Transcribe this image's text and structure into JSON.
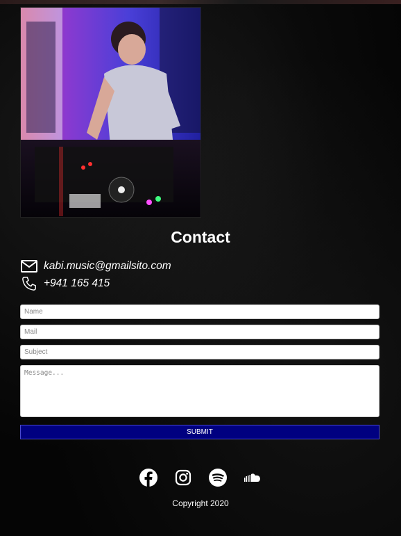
{
  "contact": {
    "title": "Contact",
    "email": "kabi.music@gmailsito.com",
    "phone": "+941 165 415"
  },
  "form": {
    "name_placeholder": "Name",
    "mail_placeholder": "Mail",
    "subject_placeholder": "Subject",
    "message_placeholder": "Message...",
    "submit_label": "SUBMIT"
  },
  "social": [
    "facebook-icon",
    "instagram-icon",
    "spotify-icon",
    "soundcloud-icon"
  ],
  "footer": {
    "copyright": "Copyright 2020"
  },
  "colors": {
    "submit_bg": "#000080",
    "background": "#050505",
    "text": "#ffffff"
  }
}
